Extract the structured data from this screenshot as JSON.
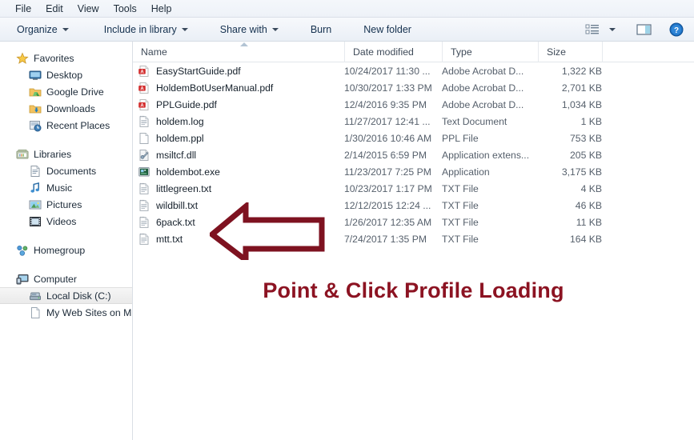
{
  "menubar": {
    "items": [
      {
        "label": "File"
      },
      {
        "label": "Edit"
      },
      {
        "label": "View"
      },
      {
        "label": "Tools"
      },
      {
        "label": "Help"
      }
    ]
  },
  "toolbar": {
    "organize": "Organize",
    "include_in_library": "Include in library",
    "share_with": "Share with",
    "burn": "Burn",
    "new_folder": "New folder",
    "view_icon": "list-view-icon",
    "view_caret_icon": "chevron-down-icon",
    "preview_pane_icon": "preview-pane-icon",
    "help_icon": "help-icon"
  },
  "sidebar": {
    "groups": [
      {
        "header": {
          "label": "Favorites",
          "icon": "star-icon"
        },
        "items": [
          {
            "label": "Desktop",
            "icon": "desktop-icon"
          },
          {
            "label": "Google Drive",
            "icon": "folder-green-icon"
          },
          {
            "label": "Downloads",
            "icon": "folder-download-icon"
          },
          {
            "label": "Recent Places",
            "icon": "recent-places-icon"
          }
        ]
      },
      {
        "header": {
          "label": "Libraries",
          "icon": "libraries-icon"
        },
        "items": [
          {
            "label": "Documents",
            "icon": "documents-icon"
          },
          {
            "label": "Music",
            "icon": "music-note-icon"
          },
          {
            "label": "Pictures",
            "icon": "pictures-icon"
          },
          {
            "label": "Videos",
            "icon": "video-icon"
          }
        ]
      },
      {
        "header": {
          "label": "Homegroup",
          "icon": "homegroup-icon"
        },
        "items": []
      },
      {
        "header": {
          "label": "Computer",
          "icon": "computer-icon"
        },
        "items": [
          {
            "label": "Local Disk (C:)",
            "icon": "hard-disk-icon",
            "selected": true
          },
          {
            "label": "My Web Sites on MS",
            "icon": "blank-page-icon"
          }
        ]
      }
    ]
  },
  "columns": {
    "name": "Name",
    "date_modified": "Date modified",
    "type": "Type",
    "size": "Size",
    "sort_indicator": "sort-ascending-icon"
  },
  "files": [
    {
      "name": "EasyStartGuide.pdf",
      "icon": "pdf-icon",
      "date": "10/24/2017 11:30 ...",
      "type": "Adobe Acrobat D...",
      "size": "1,322 KB"
    },
    {
      "name": "HoldemBotUserManual.pdf",
      "icon": "pdf-icon",
      "date": "10/30/2017 1:33 PM",
      "type": "Adobe Acrobat D...",
      "size": "2,701 KB"
    },
    {
      "name": "PPLGuide.pdf",
      "icon": "pdf-icon",
      "date": "12/4/2016 9:35 PM",
      "type": "Adobe Acrobat D...",
      "size": "1,034 KB"
    },
    {
      "name": "holdem.log",
      "icon": "text-icon",
      "date": "11/27/2017 12:41 ...",
      "type": "Text Document",
      "size": "1 KB"
    },
    {
      "name": "holdem.ppl",
      "icon": "blank-icon",
      "date": "1/30/2016 10:46 AM",
      "type": "PPL File",
      "size": "753 KB"
    },
    {
      "name": "msiltcf.dll",
      "icon": "dll-icon",
      "date": "2/14/2015 6:59 PM",
      "type": "Application extens...",
      "size": "205 KB"
    },
    {
      "name": "holdembot.exe",
      "icon": "exe-icon",
      "date": "11/23/2017 7:25 PM",
      "type": "Application",
      "size": "3,175 KB"
    },
    {
      "name": "littlegreen.txt",
      "icon": "text-icon",
      "date": "10/23/2017 1:17 PM",
      "type": "TXT File",
      "size": "4 KB"
    },
    {
      "name": "wildbill.txt",
      "icon": "text-icon",
      "date": "12/12/2015 12:24 ...",
      "type": "TXT File",
      "size": "46 KB"
    },
    {
      "name": "6pack.txt",
      "icon": "text-icon",
      "date": "1/26/2017 12:35 AM",
      "type": "TXT File",
      "size": "11 KB"
    },
    {
      "name": "mtt.txt",
      "icon": "text-icon",
      "date": "7/24/2017 1:35 PM",
      "type": "TXT File",
      "size": "164 KB"
    }
  ],
  "annotation": {
    "caption": "Point & Click Profile Loading",
    "caption_color": "#8C1322",
    "arrow_icon": "left-arrow-annotation",
    "arrow_color": "#7E1220",
    "arrow_points_at": "wildbill.txt"
  }
}
